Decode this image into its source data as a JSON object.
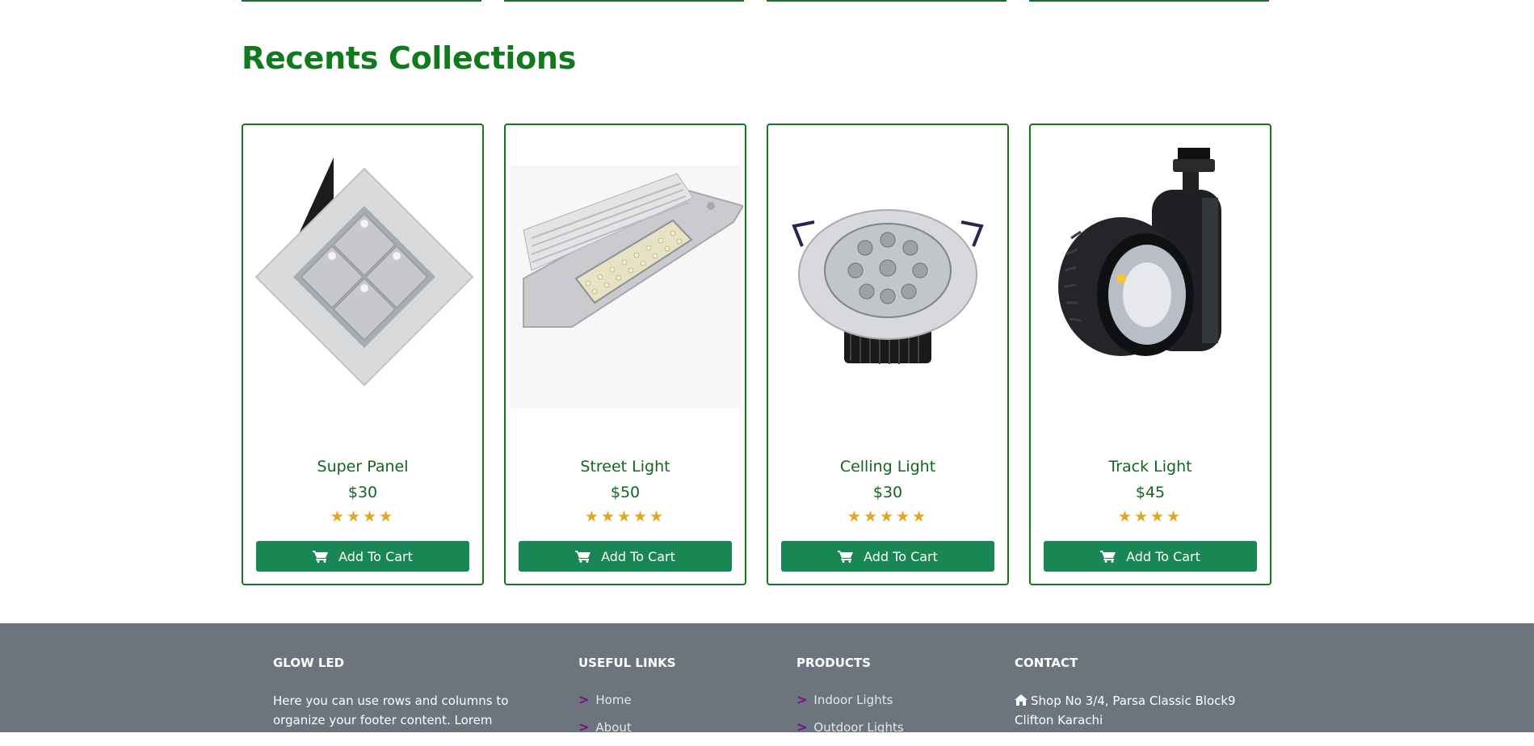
{
  "section": {
    "title": "Recents Collections"
  },
  "products": [
    {
      "name": "Super Panel",
      "price": "$30",
      "rating": 4,
      "stars": "★★★★",
      "button": "Add To Cart"
    },
    {
      "name": "Street Light",
      "price": "$50",
      "rating": 5,
      "stars": "★★★★★",
      "button": "Add To Cart"
    },
    {
      "name": "Celling Light",
      "price": "$30",
      "rating": 5,
      "stars": "★★★★★",
      "button": "Add To Cart"
    },
    {
      "name": "Track Light",
      "price": "$45",
      "rating": 4,
      "stars": "★★★★",
      "button": "Add To Cart"
    }
  ],
  "footer": {
    "brand": {
      "title": "GLOW LED",
      "text": "Here you can use rows and columns to organize your footer content. Lorem"
    },
    "useful_links": {
      "title": "USEFUL LINKS",
      "items": [
        "Home",
        "About"
      ]
    },
    "products": {
      "title": "PRODUCTS",
      "items": [
        "Indoor Lights",
        "Outdoor Lights"
      ]
    },
    "contact": {
      "title": "CONTACT",
      "address": "Shop No 3/4, Parsa Classic Block9 Clifton Karachi",
      "icon": "home-icon"
    }
  },
  "colors": {
    "accent": "#117a1e",
    "button": "#198754",
    "star": "#e0a81e",
    "footer_bg": "#6c757d",
    "link_chevron": "#7a0a8a"
  }
}
